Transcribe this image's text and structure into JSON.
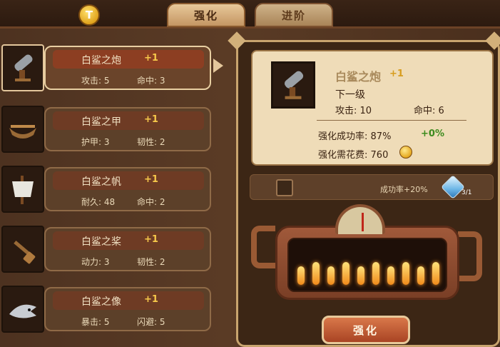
{
  "header": {
    "currency_icon": "coin-icon",
    "currency_badge_letter": "T",
    "tabs": [
      {
        "label": "强化",
        "active": true
      },
      {
        "label": "进阶",
        "active": false
      }
    ]
  },
  "equipment": [
    {
      "name": "白鲨之炮",
      "level": "+1",
      "icon": "cannon-icon",
      "stats": [
        {
          "label": "攻击",
          "value": "5"
        },
        {
          "label": "命中",
          "value": "3"
        }
      ],
      "selected": true
    },
    {
      "name": "白鲨之甲",
      "level": "+1",
      "icon": "hull-icon",
      "stats": [
        {
          "label": "护甲",
          "value": "3"
        },
        {
          "label": "韧性",
          "value": "2"
        }
      ],
      "selected": false
    },
    {
      "name": "白鲨之帆",
      "level": "+1",
      "icon": "sail-icon",
      "stats": [
        {
          "label": "耐久",
          "value": "48"
        },
        {
          "label": "命中",
          "value": "2"
        }
      ],
      "selected": false
    },
    {
      "name": "白鲨之桨",
      "level": "+1",
      "icon": "oar-icon",
      "stats": [
        {
          "label": "动力",
          "value": "3"
        },
        {
          "label": "韧性",
          "value": "2"
        }
      ],
      "selected": false
    },
    {
      "name": "白鲨之像",
      "level": "+1",
      "icon": "shark-figurehead-icon",
      "stats": [
        {
          "label": "暴击",
          "value": "5"
        },
        {
          "label": "闪避",
          "value": "5"
        }
      ],
      "selected": false
    }
  ],
  "detail": {
    "name": "白鲨之炮",
    "level": "+1",
    "next_level_label": "下一级",
    "stats": [
      {
        "label": "攻击",
        "value": "10"
      },
      {
        "label": "命中",
        "value": "6"
      }
    ],
    "success_rate_label": "强化成功率:",
    "success_rate": "87%",
    "success_rate_bonus": "+0%",
    "cost_label": "强化需花费:",
    "cost": "760"
  },
  "bonus": {
    "text": "成功率+20%",
    "count": "3/1",
    "icon": "crystal-icon"
  },
  "furnace": {
    "gauge_level": 0.5
  },
  "upgrade_button": "强化",
  "colors": {
    "accent_gold": "#f6c84a",
    "button_red": "#a94424",
    "card_bg": "#efdcb8",
    "bonus_green": "#3d8b1e"
  }
}
